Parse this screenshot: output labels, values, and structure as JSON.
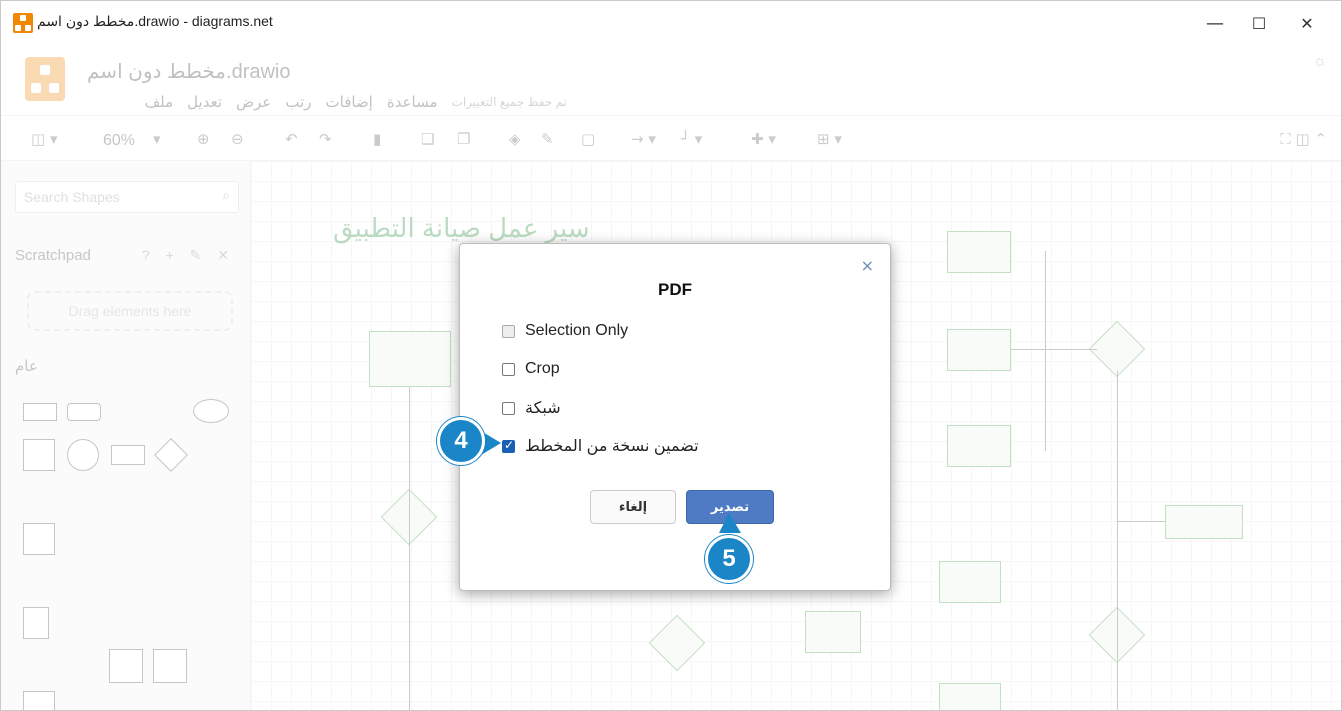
{
  "window": {
    "title": "مخطط دون اسم.drawio - diagrams.net",
    "minimize": "—",
    "maximize": "☐",
    "close": "✕"
  },
  "app": {
    "doc_title": "مخطط دون اسم.drawio",
    "menu": [
      "ملف",
      "تعديل",
      "عرض",
      "رتب",
      "إضافات",
      "مساعدة"
    ],
    "saved_status": "تم حفظ جميع التغييرات",
    "zoom": "60%"
  },
  "sidebar": {
    "search_placeholder": "Search Shapes",
    "scratchpad_label": "Scratchpad",
    "scratchpad_tools": "? + ✎ ✕",
    "drag_hint": "Drag elements here",
    "general_label": "عام"
  },
  "canvas": {
    "heading": "سير عمل صيانة التطبيق"
  },
  "dialog": {
    "title": "PDF",
    "close": "×",
    "options": [
      {
        "label": "Selection Only",
        "checked": false,
        "disabled": true
      },
      {
        "label": "Crop",
        "checked": false,
        "disabled": false
      },
      {
        "label": "شبكة",
        "checked": false,
        "disabled": false
      },
      {
        "label": "تضمين نسخة من المخطط",
        "checked": true,
        "disabled": false
      }
    ],
    "cancel_label": "إلغاء",
    "export_label": "تصدير"
  },
  "callouts": {
    "step4": "4",
    "step5": "5",
    "color": "#1b86c7"
  },
  "colors": {
    "accent": "#4f7bc5",
    "drawio_orange": "#f08705",
    "diagram_green": "#3a9a3a"
  }
}
